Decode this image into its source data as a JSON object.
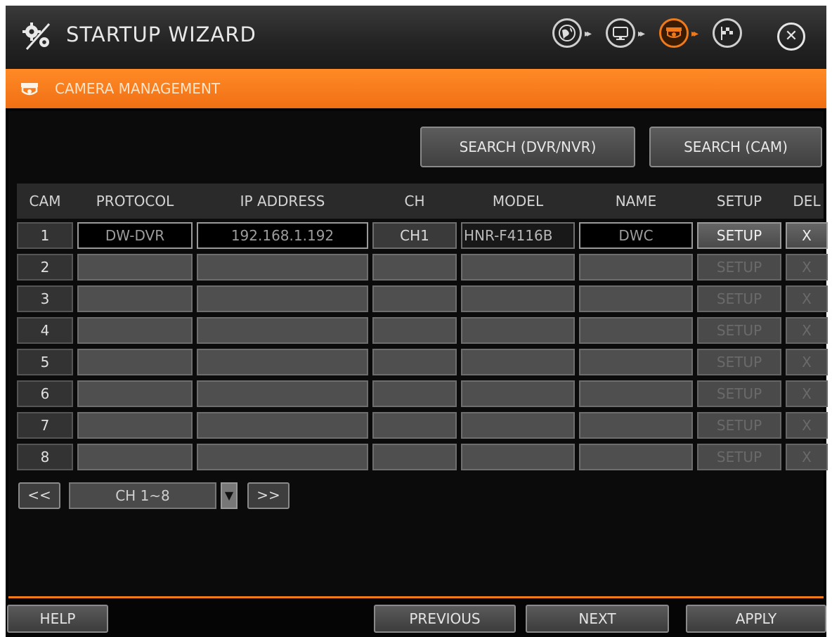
{
  "title": {
    "app_title": "STARTUP WIZARD",
    "title_icon": "gears-icon",
    "steps": [
      {
        "name": "network-globe-icon",
        "active": false
      },
      {
        "name": "monitor-icon",
        "active": false
      },
      {
        "name": "camera-icon",
        "active": true
      },
      {
        "name": "finish-flag-icon",
        "active": false
      }
    ],
    "close_icon": "close-icon"
  },
  "banner": {
    "label": "CAMERA MANAGEMENT",
    "icon": "camera-icon"
  },
  "toolbar": {
    "search_dvr_label": "SEARCH (DVR/NVR)",
    "search_cam_label": "SEARCH (CAM)"
  },
  "table": {
    "headers": [
      "CAM",
      "PROTOCOL",
      "IP ADDRESS",
      "CH",
      "MODEL",
      "NAME",
      "SETUP",
      "DEL"
    ],
    "rows": [
      {
        "cam": "1",
        "protocol": "DW-DVR",
        "ip": "192.168.1.192",
        "ch": "CH1",
        "model": "HNR-F4116B",
        "name": "DWC",
        "setup": "SETUP",
        "del": "X",
        "enabled": true
      },
      {
        "cam": "2",
        "protocol": "",
        "ip": "",
        "ch": "",
        "model": "",
        "name": "",
        "setup": "SETUP",
        "del": "X",
        "enabled": false
      },
      {
        "cam": "3",
        "protocol": "",
        "ip": "",
        "ch": "",
        "model": "",
        "name": "",
        "setup": "SETUP",
        "del": "X",
        "enabled": false
      },
      {
        "cam": "4",
        "protocol": "",
        "ip": "",
        "ch": "",
        "model": "",
        "name": "",
        "setup": "SETUP",
        "del": "X",
        "enabled": false
      },
      {
        "cam": "5",
        "protocol": "",
        "ip": "",
        "ch": "",
        "model": "",
        "name": "",
        "setup": "SETUP",
        "del": "X",
        "enabled": false
      },
      {
        "cam": "6",
        "protocol": "",
        "ip": "",
        "ch": "",
        "model": "",
        "name": "",
        "setup": "SETUP",
        "del": "X",
        "enabled": false
      },
      {
        "cam": "7",
        "protocol": "",
        "ip": "",
        "ch": "",
        "model": "",
        "name": "",
        "setup": "SETUP",
        "del": "X",
        "enabled": false
      },
      {
        "cam": "8",
        "protocol": "",
        "ip": "",
        "ch": "",
        "model": "",
        "name": "",
        "setup": "SETUP",
        "del": "X",
        "enabled": false
      }
    ]
  },
  "pager": {
    "prev_label": "<<",
    "next_label": ">>",
    "selected": "CH 1~8"
  },
  "footer": {
    "help_label": "HELP",
    "previous_label": "PREVIOUS",
    "next_label": "NEXT",
    "apply_label": "APPLY"
  },
  "colors": {
    "accent": "#f07a1a",
    "background": "#050505"
  }
}
